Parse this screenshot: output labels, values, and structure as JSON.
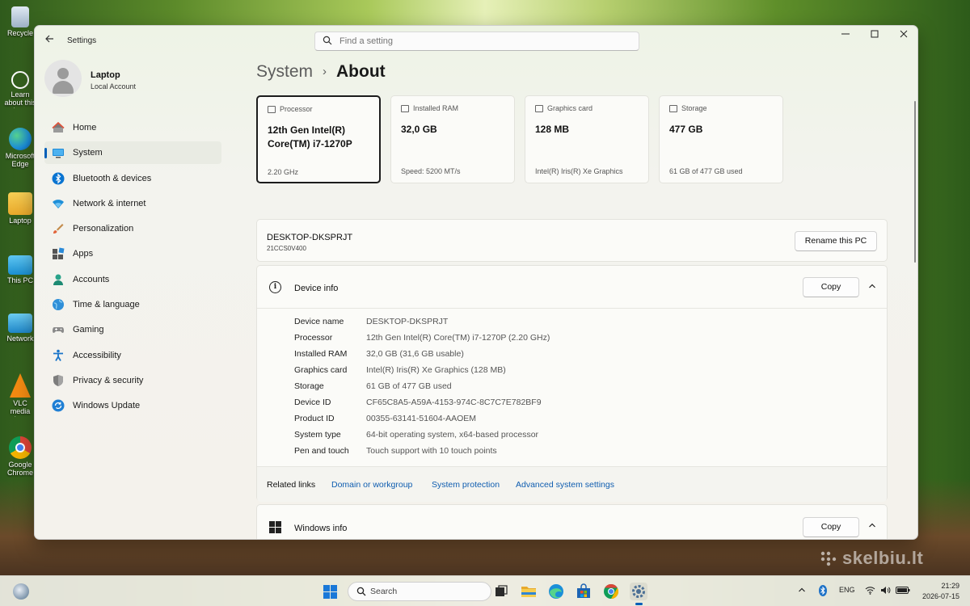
{
  "desktop": {
    "icons": [
      {
        "label": "Recycle Bin",
        "icon": "recycle-bin-icon"
      },
      {
        "label": "Learn about this picture",
        "icon": "learn-icon"
      },
      {
        "label": "Microsoft Edge",
        "icon": "edge-icon"
      },
      {
        "label": "Laptop",
        "icon": "folder-user-icon"
      },
      {
        "label": "This PC",
        "icon": "this-pc-icon"
      },
      {
        "label": "Network",
        "icon": "network-icon"
      },
      {
        "label": "VLC media player",
        "icon": "vlc-icon"
      },
      {
        "label": "Google Chrome",
        "icon": "chrome-icon"
      }
    ],
    "watermark": "skelbiu.lt"
  },
  "window": {
    "app_title": "Settings",
    "search_placeholder": "Find a setting",
    "controls": [
      "minimize",
      "maximize",
      "close"
    ]
  },
  "profile": {
    "name": "Laptop",
    "account": "Local Account"
  },
  "nav": {
    "items": [
      {
        "label": "Home",
        "icon": "home-icon"
      },
      {
        "label": "System",
        "icon": "system-icon",
        "active": true
      },
      {
        "label": "Bluetooth & devices",
        "icon": "bluetooth-icon"
      },
      {
        "label": "Network & internet",
        "icon": "wifi-icon"
      },
      {
        "label": "Personalization",
        "icon": "brush-icon"
      },
      {
        "label": "Apps",
        "icon": "apps-icon"
      },
      {
        "label": "Accounts",
        "icon": "accounts-icon"
      },
      {
        "label": "Time & language",
        "icon": "globe-icon"
      },
      {
        "label": "Gaming",
        "icon": "gamepad-icon"
      },
      {
        "label": "Accessibility",
        "icon": "accessibility-icon"
      },
      {
        "label": "Privacy & security",
        "icon": "shield-icon"
      },
      {
        "label": "Windows Update",
        "icon": "update-icon"
      }
    ]
  },
  "breadcrumb": {
    "parent": "System",
    "separator": "›",
    "current": "About"
  },
  "cards": [
    {
      "head": "Processor",
      "value": "12th Gen Intel(R) Core(TM) i7-1270P",
      "sub": "2.20 GHz",
      "selected": true
    },
    {
      "head": "Installed RAM",
      "value": "32,0 GB",
      "sub": "Speed: 5200 MT/s"
    },
    {
      "head": "Graphics card",
      "value": "128 MB",
      "sub": "Intel(R) Iris(R) Xe Graphics"
    },
    {
      "head": "Storage",
      "value": "477 GB",
      "sub": "61 GB of 477 GB used"
    }
  ],
  "pc": {
    "name": "DESKTOP-DKSPRJT",
    "model": "21CCS0V400",
    "rename_label": "Rename this PC"
  },
  "device_info": {
    "title": "Device info",
    "copy_label": "Copy",
    "specs": [
      {
        "label": "Device name",
        "value": "DESKTOP-DKSPRJT"
      },
      {
        "label": "Processor",
        "value": "12th Gen Intel(R) Core(TM) i7-1270P (2.20 GHz)"
      },
      {
        "label": "Installed RAM",
        "value": "32,0 GB (31,6 GB usable)"
      },
      {
        "label": "Graphics card",
        "value": "Intel(R) Iris(R) Xe Graphics (128 MB)"
      },
      {
        "label": "Storage",
        "value": "61 GB of 477 GB used"
      },
      {
        "label": "Device ID",
        "value": "CF65C8A5-A59A-4153-974C-8C7C7E782BF9"
      },
      {
        "label": "Product ID",
        "value": "00355-63141-51604-AAOEM"
      },
      {
        "label": "System type",
        "value": "64-bit operating system, x64-based processor"
      },
      {
        "label": "Pen and touch",
        "value": "Touch support with 10 touch points"
      }
    ],
    "related_label": "Related links",
    "related_links": [
      "Domain or workgroup",
      "System protection",
      "Advanced system settings"
    ]
  },
  "windows_info": {
    "title": "Windows info",
    "copy_label": "Copy"
  },
  "taskbar": {
    "search_label": "Search",
    "language": "ENG",
    "time": "21:29",
    "date": "2026-07-15",
    "apps": [
      "task-view-icon",
      "file-explorer-icon",
      "edge-icon",
      "store-icon",
      "chrome-icon",
      "settings-icon"
    ]
  },
  "colors": {
    "accent": "#005fb8",
    "link": "#0f5db0"
  }
}
